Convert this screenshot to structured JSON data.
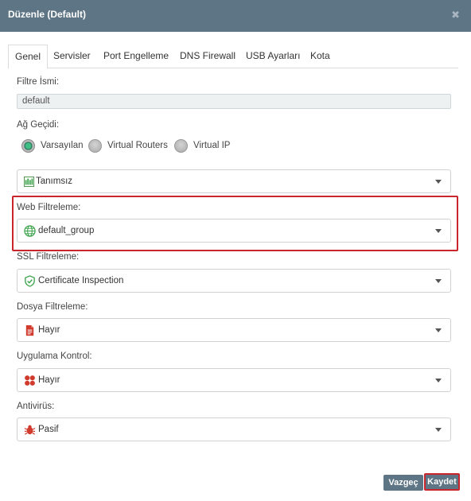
{
  "window": {
    "title": "Düzenle (Default)",
    "close_glyph": "✖"
  },
  "tabs": [
    {
      "label": "Genel",
      "active": true
    },
    {
      "label": "Servisler"
    },
    {
      "label": "Port Engelleme"
    },
    {
      "label": "DNS Firewall"
    },
    {
      "label": "USB Ayarları"
    },
    {
      "label": "Kota"
    }
  ],
  "filter_name": {
    "label": "Filtre İsmi:",
    "value": "default"
  },
  "gateway": {
    "label": "Ağ Geçidi:",
    "options": [
      {
        "label": "Varsayılan",
        "checked": true
      },
      {
        "label": "Virtual Routers",
        "checked": false
      },
      {
        "label": "Virtual IP",
        "checked": false
      }
    ],
    "selected": {
      "value": "Tanımsız",
      "icon": "network-icon"
    }
  },
  "web_filter": {
    "label": "Web Filtreleme:",
    "value": "default_group",
    "icon": "globe-icon",
    "accent": "#3aa34a"
  },
  "ssl_filter": {
    "label": "SSL Filtreleme:",
    "value": "Certificate Inspection",
    "icon": "shield-check-icon",
    "accent": "#3aa34a"
  },
  "file_filter": {
    "label": "Dosya Filtreleme:",
    "value": "Hayır",
    "icon": "file-icon",
    "accent": "#d03b2e"
  },
  "app_control": {
    "label": "Uygulama Kontrol:",
    "value": "Hayır",
    "icon": "app-grid-icon",
    "accent": "#d03b2e"
  },
  "antivirus": {
    "label": "Antivirüs:",
    "value": "Pasif",
    "icon": "bug-icon",
    "accent": "#d03b2e"
  },
  "buttons": {
    "cancel": "Vazgeç",
    "save": "Kaydet"
  },
  "colors": {
    "header": "#5e7585",
    "highlight": "#c9252d"
  }
}
